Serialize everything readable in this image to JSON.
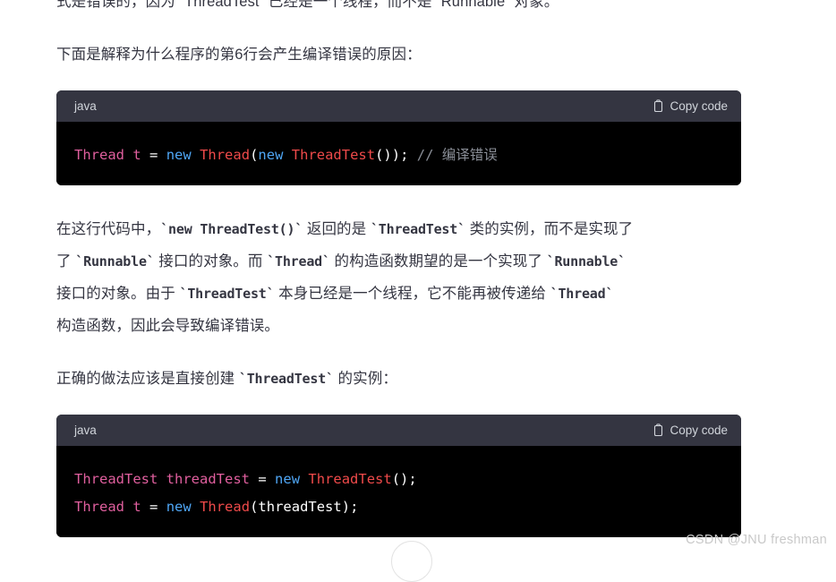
{
  "document": {
    "paragraphs": {
      "p0_clipped": "式是错误的，因为 `ThreadTest` 已经是一个线程，而不是 `Runnable` 对象。",
      "p1": "下面是解释为什么程序的第6行会产生编译错误的原因：",
      "p2_line1_a": "在这行代码中，",
      "p2_code1": "`new ThreadTest()`",
      "p2_line1_b": " 返回的是 ",
      "p2_code2": "`ThreadTest`",
      "p2_line1_c": " 类的实例，而不是实现了 ",
      "p2_code3": "`Runnable`",
      "p2_line2_a": " 接口的对象。而 ",
      "p2_code4": "`Thread`",
      "p2_line2_b": " 的构造函数期望的是一个实现了 ",
      "p2_code5": "`Runnable`",
      "p2_line3_a": " 接口的对象。由于 ",
      "p2_code6": "`ThreadTest`",
      "p2_line3_b": " 本身已经是一个线程，它不能再被传递给 ",
      "p2_code7": "`Thread`",
      "p2_line4": " 构造函数，因此会导致编译错误。",
      "p3_a": "正确的做法应该是直接创建 ",
      "p3_code": "`ThreadTest`",
      "p3_b": " 的实例："
    },
    "code_blocks": [
      {
        "language": "java",
        "copy_label": "Copy code",
        "copy_icon": "clipboard-icon",
        "lines": [
          {
            "tokens": [
              {
                "text": "Thread",
                "kind": "type"
              },
              {
                "text": " ",
                "kind": "plain"
              },
              {
                "text": "t",
                "kind": "var"
              },
              {
                "text": " ",
                "kind": "plain"
              },
              {
                "text": "=",
                "kind": "plain"
              },
              {
                "text": " ",
                "kind": "plain"
              },
              {
                "text": "new",
                "kind": "kw"
              },
              {
                "text": " ",
                "kind": "plain"
              },
              {
                "text": "Thread",
                "kind": "cls"
              },
              {
                "text": "(",
                "kind": "punct"
              },
              {
                "text": "new",
                "kind": "kw"
              },
              {
                "text": " ",
                "kind": "plain"
              },
              {
                "text": "ThreadTest",
                "kind": "cls"
              },
              {
                "text": "());",
                "kind": "punct"
              },
              {
                "text": " ",
                "kind": "plain"
              },
              {
                "text": "// 编译错误",
                "kind": "cmt"
              }
            ]
          }
        ]
      },
      {
        "language": "java",
        "copy_label": "Copy code",
        "copy_icon": "clipboard-icon",
        "lines": [
          {
            "tokens": [
              {
                "text": "ThreadTest",
                "kind": "type"
              },
              {
                "text": " ",
                "kind": "plain"
              },
              {
                "text": "threadTest",
                "kind": "var"
              },
              {
                "text": " ",
                "kind": "plain"
              },
              {
                "text": "=",
                "kind": "plain"
              },
              {
                "text": " ",
                "kind": "plain"
              },
              {
                "text": "new",
                "kind": "kw"
              },
              {
                "text": " ",
                "kind": "plain"
              },
              {
                "text": "ThreadTest",
                "kind": "cls"
              },
              {
                "text": "();",
                "kind": "punct"
              }
            ]
          },
          {
            "tokens": [
              {
                "text": "Thread",
                "kind": "type"
              },
              {
                "text": " ",
                "kind": "plain"
              },
              {
                "text": "t",
                "kind": "var"
              },
              {
                "text": " ",
                "kind": "plain"
              },
              {
                "text": "=",
                "kind": "plain"
              },
              {
                "text": " ",
                "kind": "plain"
              },
              {
                "text": "new",
                "kind": "kw"
              },
              {
                "text": " ",
                "kind": "plain"
              },
              {
                "text": "Thread",
                "kind": "cls"
              },
              {
                "text": "(",
                "kind": "punct"
              },
              {
                "text": "threadTest",
                "kind": "arg"
              },
              {
                "text": ");",
                "kind": "punct"
              }
            ]
          }
        ]
      }
    ],
    "watermark": "CSDN @JNU freshman",
    "colors": {
      "page_background": "#ffffff",
      "text": "#343541",
      "code_header_bg": "#343541",
      "code_body_bg": "#000000",
      "token_type": "#e05f9e",
      "token_keyword": "#4fa6f5",
      "token_class": "#ef4a4a",
      "token_plain": "#ffffff",
      "token_comment": "#8b8f98",
      "header_text": "#d1d5db",
      "watermark": "#c9c9c9"
    }
  }
}
